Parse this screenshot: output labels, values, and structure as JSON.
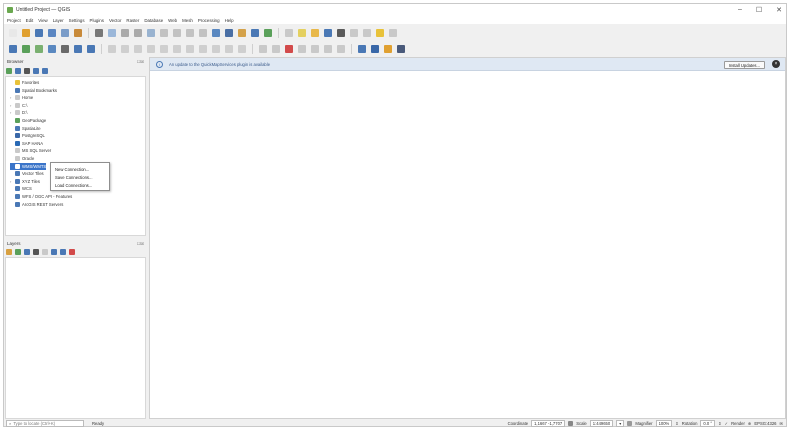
{
  "window": {
    "title": "Untitled Project — QGIS",
    "controls": [
      "–",
      "☐",
      "✕"
    ]
  },
  "menubar": [
    "Project",
    "Edit",
    "View",
    "Layer",
    "Settings",
    "Plugins",
    "Vector",
    "Raster",
    "Database",
    "Web",
    "Mesh",
    "Processing",
    "Help"
  ],
  "toolbar1": [
    {
      "icon": "new-project-icon",
      "color": "#e8e8e8"
    },
    {
      "icon": "open-project-icon",
      "color": "#e0a030"
    },
    {
      "icon": "save-project-icon",
      "color": "#4a78b5"
    },
    {
      "icon": "save-as-icon",
      "color": "#5b86c2"
    },
    {
      "icon": "print-layout-icon",
      "color": "#7a9cc8"
    },
    {
      "icon": "style-manager-icon",
      "color": "#c88a3a"
    },
    {
      "sep": true
    },
    {
      "icon": "pan-map-icon",
      "color": "#777777"
    },
    {
      "icon": "pan-to-selection-icon",
      "color": "#9bb7d9"
    },
    {
      "icon": "zoom-in-icon",
      "color": "#aaaaaa"
    },
    {
      "icon": "zoom-out-icon",
      "color": "#aaaaaa"
    },
    {
      "icon": "zoom-full-icon",
      "color": "#99b3d0"
    },
    {
      "icon": "zoom-to-selection-icon",
      "color": "#c2c2c2"
    },
    {
      "icon": "zoom-to-layer-icon",
      "color": "#c2c2c2"
    },
    {
      "icon": "zoom-last-icon",
      "color": "#c2c2c2"
    },
    {
      "icon": "zoom-next-icon",
      "color": "#c2c2c2"
    },
    {
      "icon": "new-map-view-icon",
      "color": "#5a88c0"
    },
    {
      "icon": "new-3d-view-icon",
      "color": "#4a6fa5"
    },
    {
      "icon": "temporal-controller-icon",
      "color": "#d4a24a"
    },
    {
      "icon": "bookmarks-icon",
      "color": "#4a78b5"
    },
    {
      "icon": "refresh-icon",
      "color": "#5aa05a"
    },
    {
      "sep": true
    },
    {
      "icon": "identify-icon",
      "color": "#c9c9c9"
    },
    {
      "icon": "select-features-icon",
      "color": "#e4d060"
    },
    {
      "icon": "deselect-icon",
      "color": "#e8b84a"
    },
    {
      "icon": "open-attribute-table-icon",
      "color": "#4a78b5"
    },
    {
      "icon": "statistical-summary-icon",
      "color": "#5a5a5a"
    },
    {
      "icon": "field-calculator-icon",
      "color": "#c9c9c9"
    },
    {
      "icon": "measure-icon",
      "color": "#c9c9c9"
    },
    {
      "icon": "map-tips-icon",
      "color": "#e8c23a"
    },
    {
      "icon": "annotation-icon",
      "color": "#c9c9c9"
    }
  ],
  "toolbar2": [
    {
      "icon": "data-source-manager-icon",
      "color": "#4a78b5"
    },
    {
      "icon": "new-shapefile-icon",
      "color": "#5aa05a"
    },
    {
      "icon": "add-vector-layer-icon",
      "color": "#7ab070"
    },
    {
      "icon": "add-raster-layer-icon",
      "color": "#5a88c0"
    },
    {
      "icon": "add-mesh-layer-icon",
      "color": "#6a6a6a"
    },
    {
      "icon": "add-delimited-text-icon",
      "color": "#4a78b5"
    },
    {
      "icon": "add-wms-layer-icon",
      "color": "#4a78b5"
    },
    {
      "sep": true
    },
    {
      "icon": "current-edits-icon",
      "color": "#cfcfcf"
    },
    {
      "icon": "toggle-editing-icon",
      "color": "#cfcfcf"
    },
    {
      "icon": "save-edits-icon",
      "color": "#cfcfcf"
    },
    {
      "icon": "digitize-icon",
      "color": "#cfcfcf"
    },
    {
      "icon": "vertex-tool-icon",
      "color": "#cfcfcf"
    },
    {
      "icon": "delete-selected-icon",
      "color": "#cfcfcf"
    },
    {
      "icon": "cut-features-icon",
      "color": "#cfcfcf"
    },
    {
      "icon": "copy-features-icon",
      "color": "#cfcfcf"
    },
    {
      "icon": "paste-features-icon",
      "color": "#cfcfcf"
    },
    {
      "icon": "undo-icon",
      "color": "#cfcfcf"
    },
    {
      "icon": "redo-icon",
      "color": "#cfcfcf"
    },
    {
      "sep": true
    },
    {
      "icon": "label-toolbar-icon",
      "color": "#c9c9c9"
    },
    {
      "icon": "label-pin-icon",
      "color": "#c9c9c9"
    },
    {
      "icon": "label-highlight-icon",
      "color": "#d24a4a"
    },
    {
      "icon": "label-show-hide-icon",
      "color": "#c9c9c9"
    },
    {
      "icon": "label-move-icon",
      "color": "#c9c9c9"
    },
    {
      "icon": "label-rotate-icon",
      "color": "#c9c9c9"
    },
    {
      "icon": "label-change-icon",
      "color": "#c9c9c9"
    },
    {
      "sep": true
    },
    {
      "icon": "processing-toolbox-icon",
      "color": "#4a78b5"
    },
    {
      "icon": "results-viewer-icon",
      "color": "#3a68a8"
    },
    {
      "icon": "python-console-icon",
      "color": "#e0a030"
    },
    {
      "icon": "graphical-modeler-icon",
      "color": "#4a5a7a"
    }
  ],
  "browser": {
    "title": "Browser",
    "controls": "☐☒",
    "tools": [
      {
        "icon": "add-selected-layers-icon",
        "color": "#5aa05a"
      },
      {
        "icon": "refresh-browser-icon",
        "color": "#4a78b5"
      },
      {
        "icon": "filter-browser-icon",
        "color": "#555555"
      },
      {
        "icon": "collapse-all-icon",
        "color": "#4a78b5"
      },
      {
        "icon": "enable-properties-icon",
        "color": "#4a78b5"
      }
    ],
    "items": [
      {
        "label": "Favorites",
        "icon": "favorites-icon",
        "color": "#e8c23a",
        "exp": ""
      },
      {
        "label": "Spatial Bookmarks",
        "icon": "bookmarks-icon",
        "color": "#4a78b5",
        "exp": ""
      },
      {
        "label": "Home",
        "icon": "home-folder-icon",
        "color": "#c9c9c9",
        "exp": "›"
      },
      {
        "label": "C:\\",
        "icon": "drive-icon",
        "color": "#c9c9c9",
        "exp": "›"
      },
      {
        "label": "D:\\",
        "icon": "drive-icon",
        "color": "#c9c9c9",
        "exp": "›"
      },
      {
        "label": "GeoPackage",
        "icon": "geopackage-icon",
        "color": "#5aa05a",
        "exp": ""
      },
      {
        "label": "SpatiaLite",
        "icon": "spatialite-icon",
        "color": "#4a78b5",
        "exp": ""
      },
      {
        "label": "PostgreSQL",
        "icon": "postgresql-icon",
        "color": "#3a68a8",
        "exp": ""
      },
      {
        "label": "SAP HANA",
        "icon": "sap-hana-icon",
        "color": "#2a6ab5",
        "exp": ""
      },
      {
        "label": "MS SQL Server",
        "icon": "mssql-icon",
        "color": "#c9c9c9",
        "exp": ""
      },
      {
        "label": "Oracle",
        "icon": "oracle-icon",
        "color": "#c9c9c9",
        "exp": ""
      },
      {
        "label": "WMS/WMTS",
        "icon": "wms-icon",
        "color": "#ffffff",
        "exp": "",
        "selected": true
      },
      {
        "label": "Vector Tiles",
        "icon": "vector-tiles-icon",
        "color": "#4a78b5",
        "exp": ""
      },
      {
        "label": "XYZ Tiles",
        "icon": "xyz-tiles-icon",
        "color": "#4a78b5",
        "exp": "›"
      },
      {
        "label": "WCS",
        "icon": "wcs-icon",
        "color": "#4a78b5",
        "exp": ""
      },
      {
        "label": "WFS / OGC API - Features",
        "icon": "wfs-icon",
        "color": "#4a78b5",
        "exp": ""
      },
      {
        "label": "ArcGIS REST Servers",
        "icon": "arcgis-icon",
        "color": "#4a78b5",
        "exp": ""
      }
    ],
    "context_menu": [
      "New Connection...",
      "Save Connections...",
      "Load Connections..."
    ]
  },
  "layers": {
    "title": "Layers",
    "controls": "☐☒",
    "tools": [
      {
        "icon": "open-layer-styling-icon",
        "color": "#d8a040"
      },
      {
        "icon": "add-group-icon",
        "color": "#5aa05a"
      },
      {
        "icon": "manage-map-themes-icon",
        "color": "#4a78b5"
      },
      {
        "icon": "filter-legend-icon",
        "color": "#555555"
      },
      {
        "icon": "filter-expression-icon",
        "color": "#c9c9c9"
      },
      {
        "icon": "expand-all-icon",
        "color": "#4a78b5"
      },
      {
        "icon": "collapse-all-icon",
        "color": "#4a78b5"
      },
      {
        "icon": "remove-layer-icon",
        "color": "#d24a4a"
      }
    ]
  },
  "message_bar": {
    "text": "An update to the QuickMapServices plugin is available",
    "button": "Install Updates...",
    "close": "×"
  },
  "statusbar": {
    "locator_placeholder": "Type to locate (Ctrl+K)",
    "ready": "Ready",
    "coordinate_label": "Coordinate",
    "coordinate_value": "1,1667 -1,7707",
    "scale_label": "Scale",
    "scale_value": "1:449650",
    "magnifier_label": "Magnifier",
    "magnifier_value": "100%",
    "rotation_label": "Rotation",
    "rotation_value": "0.0 °",
    "render_label": "Render",
    "crs": "EPSG:4326"
  }
}
